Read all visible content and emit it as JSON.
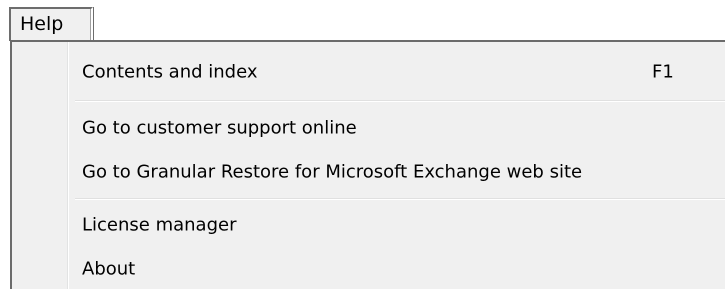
{
  "menubar": {
    "help_label": "Help"
  },
  "menu": {
    "items": [
      {
        "label": "Contents and index",
        "shortcut": "F1"
      },
      {
        "label": "Go to customer support online"
      },
      {
        "label": "Go to Granular Restore for Microsoft Exchange web site"
      },
      {
        "label": "License manager"
      },
      {
        "label": "About"
      }
    ]
  },
  "colors": {
    "menu_background": "#f0f0f0",
    "menu_border": "#6b6b6b",
    "text": "#000000"
  }
}
